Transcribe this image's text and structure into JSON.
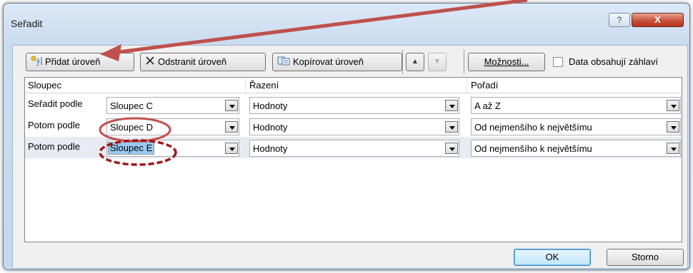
{
  "window": {
    "title": "Seřadit",
    "help_label": "?",
    "close_label": "X"
  },
  "toolbar": {
    "add_level": "Přidat úroveň",
    "remove_level": "Odstranit úroveň",
    "copy_level": "Kopírovat úroveň",
    "move_up": "▲",
    "move_down": "▼",
    "options": "Možnosti...",
    "header_checkbox_label": "Data obsahují záhlaví",
    "header_checkbox_checked": false
  },
  "grid": {
    "columns": [
      "Sloupec",
      "Řazení",
      "Pořadí"
    ],
    "rows": [
      {
        "label": "Seřadit podle",
        "column": "Sloupec C",
        "sort_on": "Hodnoty",
        "order": "A až Z"
      },
      {
        "label": "Potom podle",
        "column": "Sloupec D",
        "sort_on": "Hodnoty",
        "order": "Od nejmenšího k největšímu"
      },
      {
        "label": "Potom podle",
        "column": "Sloupec E",
        "sort_on": "Hodnoty",
        "order": "Od nejmenšího k největšímu"
      }
    ],
    "selected_row": 3
  },
  "footer": {
    "ok": "OK",
    "cancel": "Storno"
  },
  "annotations": {
    "arrow_color": "#c0504d",
    "ellipse_color": "#c0504d",
    "dashed_ellipse_color": "#a0171b"
  }
}
